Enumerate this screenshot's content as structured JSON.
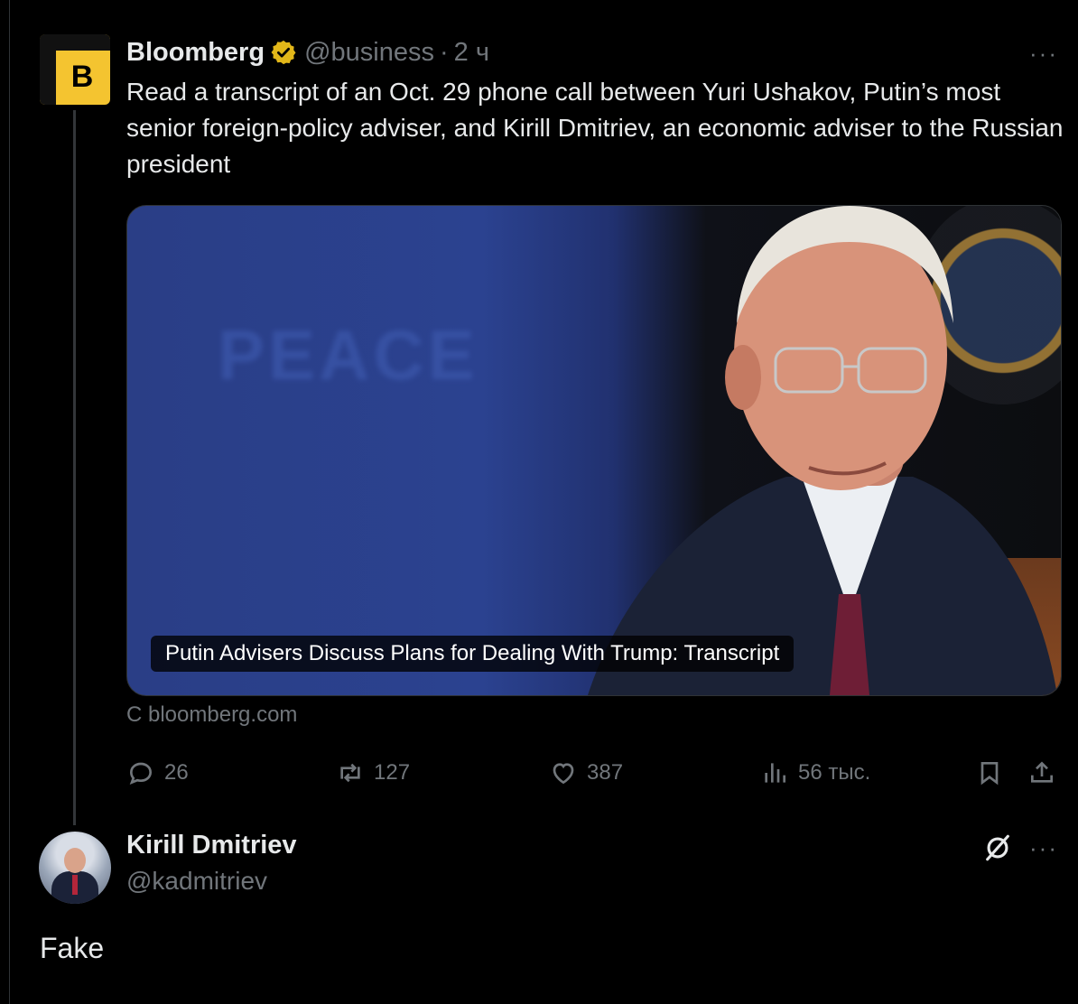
{
  "parent_tweet": {
    "avatar_letter": "B",
    "display_name": "Bloomberg",
    "handle": "@business",
    "separator": "·",
    "time": "2 ч",
    "more_label": "···",
    "text": "Read a transcript of an Oct. 29 phone call between Yuri Ushakov, Putin’s most senior foreign-policy adviser, and Kirill Dmitriev, an economic adviser to the Russian president",
    "card": {
      "caption": "Putin Advisers Discuss Plans for Dealing With Trump: Transcript",
      "background_word": "PEACE"
    },
    "source": "С bloomberg.com",
    "actions": {
      "replies": "26",
      "reposts": "127",
      "likes": "387",
      "views": "56 тыс."
    }
  },
  "reply": {
    "display_name": "Kirill Dmitriev",
    "handle": "@kadmitriev",
    "more_label": "···",
    "text": "Fake"
  },
  "colors": {
    "background": "#000000",
    "text": "#e7e9ea",
    "muted": "#71767b",
    "bloomberg_yellow": "#f4c430",
    "verified_gold": "#e2b719"
  }
}
